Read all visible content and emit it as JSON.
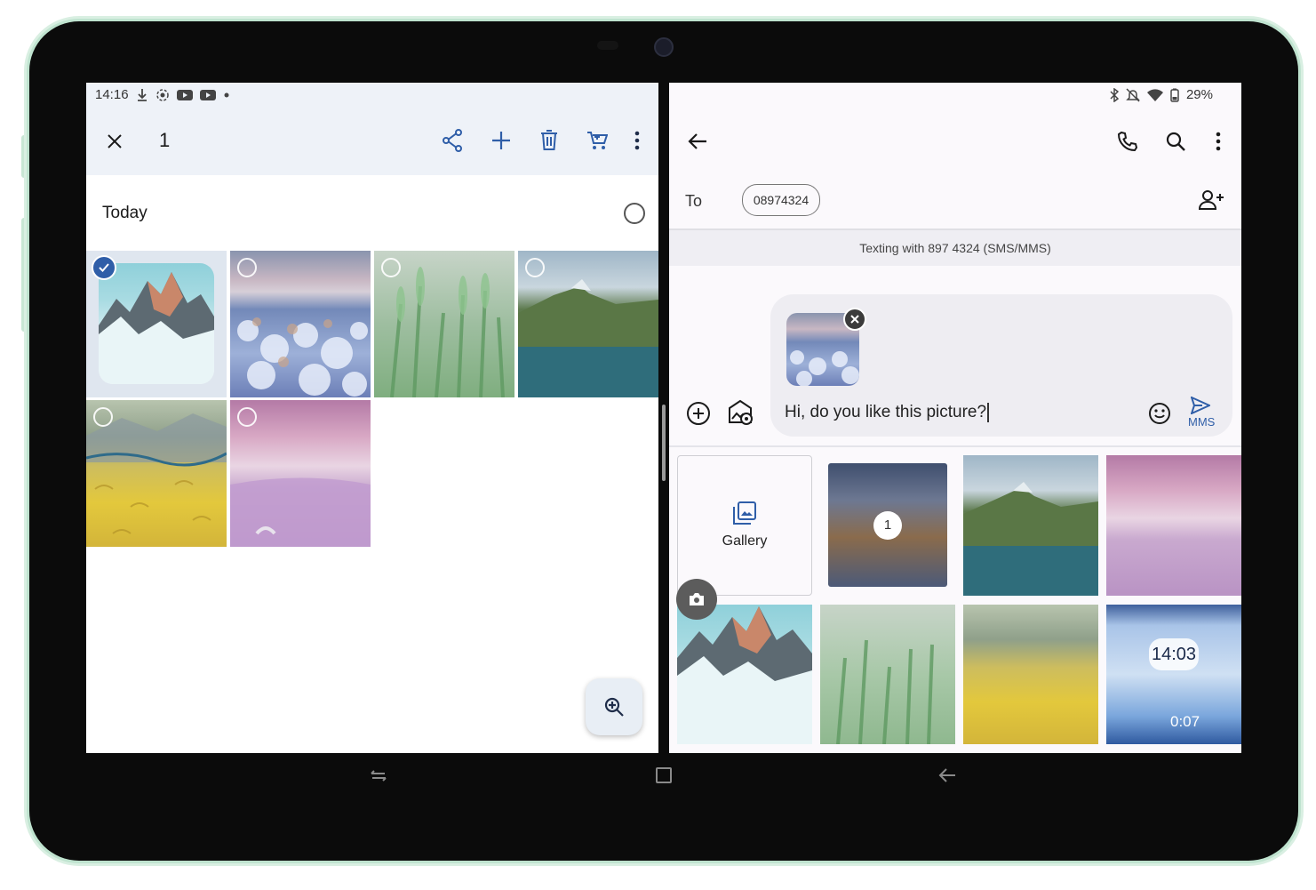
{
  "left": {
    "status": {
      "time": "14:16",
      "icons": [
        "download-icon",
        "screen-record-icon",
        "youtube-icon",
        "youtube-icon",
        "dot-icon"
      ]
    },
    "selection_count": "1",
    "toolbar": [
      "close-icon",
      "share-icon",
      "add-icon",
      "delete-icon",
      "shopping-cart-icon",
      "more-vert-icon"
    ],
    "section_title": "Today",
    "photos": [
      {
        "name": "mountain-snow",
        "selected": true
      },
      {
        "name": "frosted-trees",
        "selected": false
      },
      {
        "name": "green-wheat",
        "selected": false
      },
      {
        "name": "mountain-lake",
        "selected": false
      },
      {
        "name": "painted-wheat-field",
        "selected": false
      },
      {
        "name": "lavender-dunes",
        "selected": false
      }
    ],
    "fab_icon": "zoom-in-icon"
  },
  "right": {
    "status": {
      "battery": "29%",
      "icons": [
        "bluetooth-icon",
        "mute-icon",
        "wifi-icon",
        "battery-icon"
      ]
    },
    "toolbar": [
      "back-arrow-icon",
      "phone-icon",
      "search-icon",
      "more-vert-icon"
    ],
    "to_label": "To",
    "recipient": "08974324",
    "banner": "Texting with 897 4324 (SMS/MMS)",
    "message_text": "Hi, do you like this picture?",
    "send_label": "MMS",
    "gallery_label": "Gallery",
    "selection_badge": "1",
    "lockscreen_clock": "14:03",
    "video_duration": "0:07"
  },
  "colors": {
    "accent": "#2f5ea8",
    "appbar": "#eef2f8",
    "bezel": "#0b0b0b",
    "frame": "#bfe3cf"
  }
}
